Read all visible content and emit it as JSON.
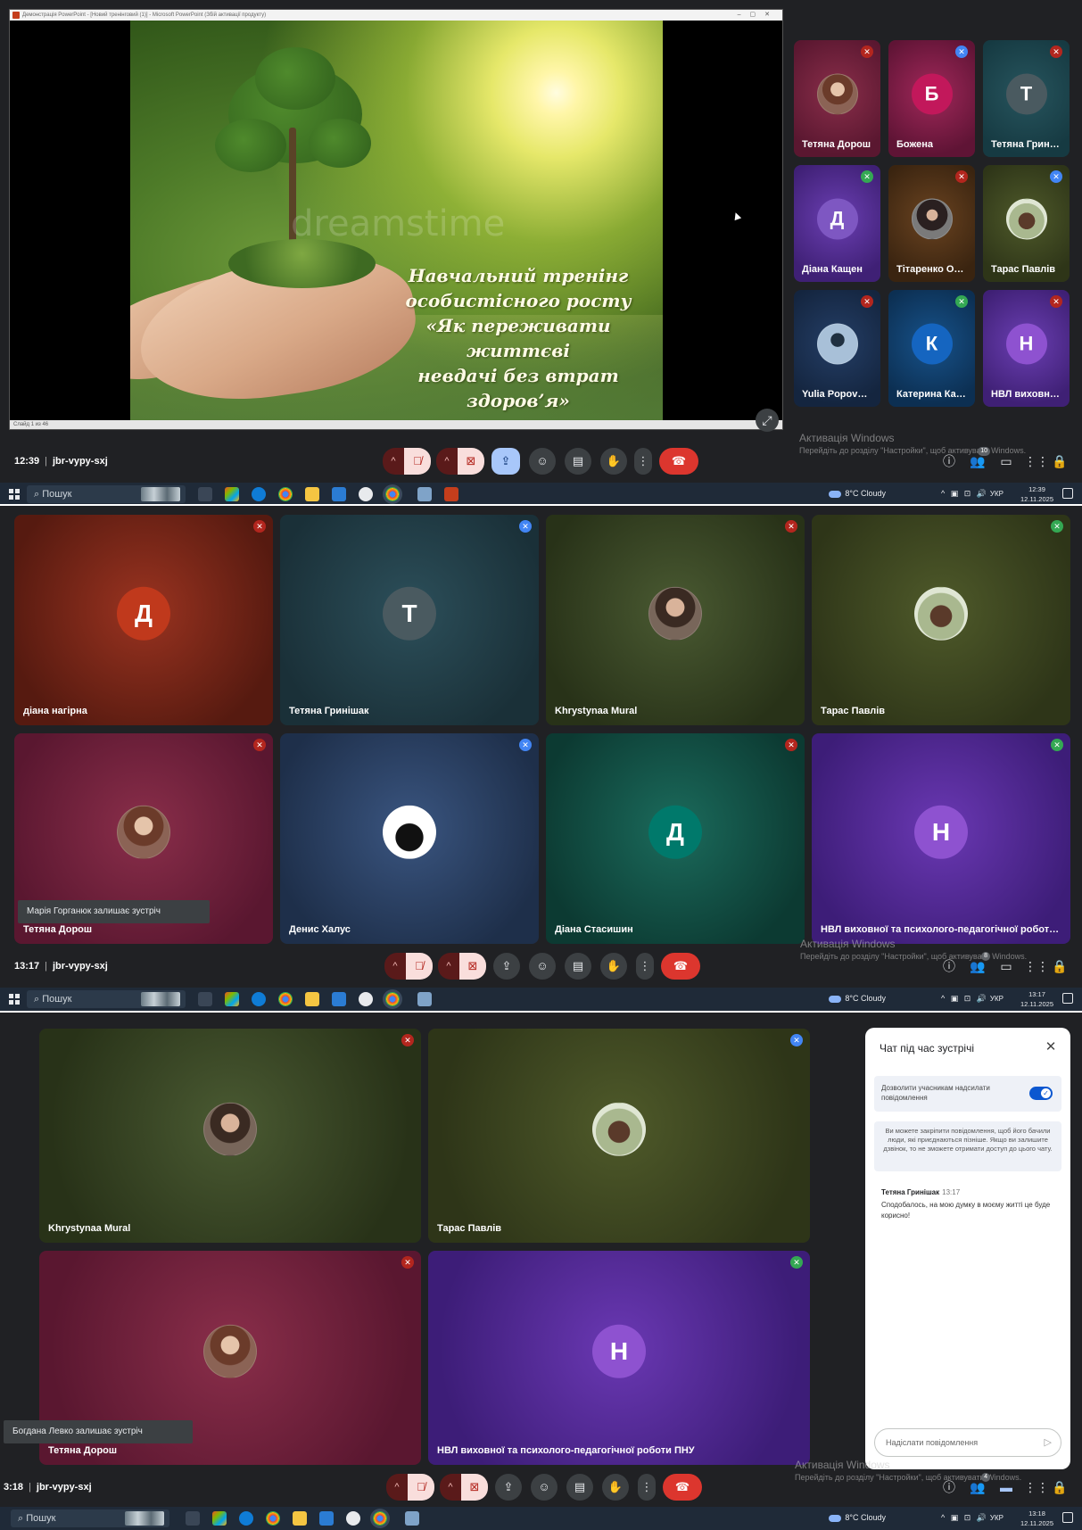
{
  "colors": {
    "meet_bg": "#202124",
    "hangup": "#dc362e",
    "accent_blue": "#a8c7fa",
    "muted_caret": "#5a1a1a",
    "taskbar": "#1f2a38"
  },
  "shot1": {
    "ppt_title": "Демонстрація PowerPoint - [Новий тренінговий (1)] - Microsoft PowerPoint (Збій активації продукту)",
    "ppt_status": "Слайд 1 из 46",
    "slide_watermark": "dreamstime",
    "slide_lines": [
      "Навчальний тренінг",
      "особистісного росту",
      "«Як переживати життєві",
      "невдачі без втрат здоров’я»"
    ],
    "participants": [
      {
        "name": "Тетяна Дорош",
        "initial": "",
        "avatar": "photo-woman",
        "bg": "crimson"
      },
      {
        "name": "Божена",
        "initial": "Б",
        "avatar": "pink",
        "bg": "pink"
      },
      {
        "name": "Тетяна Гриніш...",
        "initial": "Т",
        "avatar": "grey",
        "bg": "teal"
      },
      {
        "name": "Діана Кащен",
        "initial": "Д",
        "avatar": "purple",
        "bg": "purple"
      },
      {
        "name": "Тітаренко Оле...",
        "initial": "",
        "avatar": "photo-dark",
        "bg": "brown"
      },
      {
        "name": "Тарас Павлів",
        "initial": "",
        "avatar": "photo-animal",
        "bg": "olive"
      },
      {
        "name": "Yulia Popovuch",
        "initial": "",
        "avatar": "photo-man",
        "bg": "navy"
      },
      {
        "name": "Катерина Кар...",
        "initial": "К",
        "avatar": "blue",
        "bg": "blue"
      },
      {
        "name": "НВЛ виховної...",
        "initial": "Н",
        "avatar": "violet",
        "bg": "purple"
      }
    ],
    "activation_title": "Активація Windows",
    "activation_sub": "Перейдіть до розділу \"Настройки\", щоб активувати Windows.",
    "time": "12:39",
    "meeting_code": "jbr-vypy-sxj",
    "people_count": "10",
    "tray_date": "12.11.2025",
    "tray_time": "12:39"
  },
  "shot2": {
    "participants": [
      {
        "name": "діана нагірна",
        "initial": "Д",
        "avatar": "red",
        "bg": "red"
      },
      {
        "name": "Тетяна Гринішак",
        "initial": "Т",
        "avatar": "grey",
        "bg": "slate"
      },
      {
        "name": "Khrystynaa Mural",
        "initial": "",
        "avatar": "photo-girl",
        "bg": "green"
      },
      {
        "name": "Тарас Павлів",
        "initial": "",
        "avatar": "photo-animal",
        "bg": "olive"
      },
      {
        "name": "Тетяна Дорош",
        "initial": "",
        "avatar": "photo-woman",
        "bg": "crimson"
      },
      {
        "name": "Денис Халус",
        "initial": "",
        "avatar": "photo-hat",
        "bg": "bluegrey"
      },
      {
        "name": "Діана Стасишин",
        "initial": "Д",
        "avatar": "teal",
        "bg": "emerald"
      },
      {
        "name": "НВЛ виховної та психолого-педагогічної роботи ПНУ",
        "initial": "Н",
        "avatar": "violet",
        "bg": "violet"
      }
    ],
    "toast": "Марія Горганюк залишає зустріч",
    "activation_title": "Активація Windows",
    "activation_sub": "Перейдіть до розділу \"Настройки\", щоб активувати Windows.",
    "time": "13:17",
    "meeting_code": "jbr-vypy-sxj",
    "people_count": "8",
    "tray_date": "12.11.2025",
    "tray_time": "13:17"
  },
  "shot3": {
    "participants": [
      {
        "name": "Khrystynaa Mural",
        "initial": "",
        "avatar": "photo-girl",
        "bg": "green"
      },
      {
        "name": "Тарас Павлів",
        "initial": "",
        "avatar": "photo-animal",
        "bg": "olive"
      },
      {
        "name": "Тетяна Дорош",
        "initial": "",
        "avatar": "photo-woman",
        "bg": "crimson"
      },
      {
        "name": "НВЛ виховної та психолого-педагогічної роботи ПНУ",
        "initial": "Н",
        "avatar": "violet",
        "bg": "violet"
      }
    ],
    "toast": "Богдана Левко залишає зустріч",
    "chat": {
      "title": "Чат під час зустрічі",
      "allow_label": "Дозволити учасникам надсилати повідомлення",
      "info": "Ви можете закріпити повідомлення, щоб його бачили люди, які приєднаються пізніше. Якщо ви залишите дзвінок, то не зможете отримати доступ до цього чату.",
      "sender": "Тетяна Гринішак",
      "sent_time": "13:17",
      "message": "Сподобалось, на мою думку в моєму житті це буде корисно!",
      "compose_placeholder": "Надіслати повідомлення"
    },
    "activation_title": "Активація Windows",
    "activation_sub": "Перейдіть до розділу \"Настройки\", щоб активувати Windows.",
    "time": "3:18",
    "meeting_code": "jbr-vypy-sxj",
    "people_count": "4",
    "tray_date": "12.11.2025",
    "tray_time": "13:18"
  },
  "taskbar": {
    "search_placeholder": "Пошук",
    "weather": "8°C Cloudy",
    "language": "УКР"
  }
}
